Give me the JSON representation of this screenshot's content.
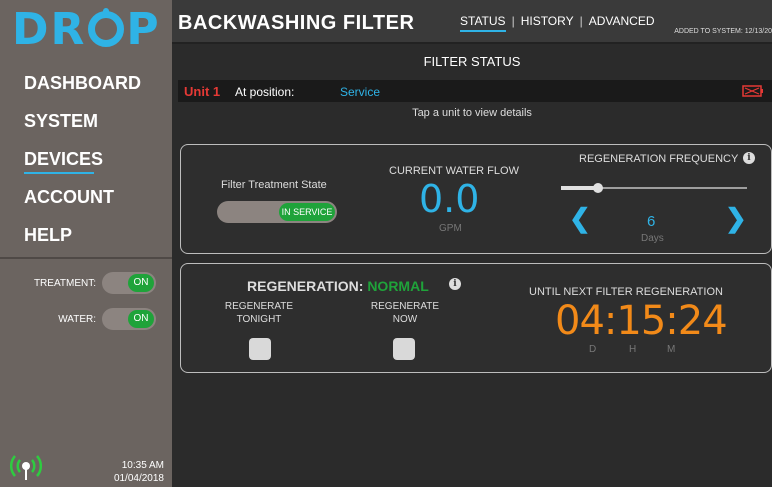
{
  "sidebar": {
    "logo": "DROP",
    "nav": [
      {
        "label": "DASHBOARD"
      },
      {
        "label": "SYSTEM"
      },
      {
        "label": "DEVICES"
      },
      {
        "label": "ACCOUNT"
      },
      {
        "label": "HELP"
      }
    ],
    "active_index": 2,
    "treatment": {
      "label": "TREATMENT:",
      "state": "ON"
    },
    "water": {
      "label": "WATER:",
      "state": "ON"
    },
    "time": "10:35 AM",
    "date": "01/04/2018"
  },
  "header": {
    "title": "BACKWASHING FILTER",
    "tabs": [
      {
        "label": "STATUS"
      },
      {
        "label": "HISTORY"
      },
      {
        "label": "ADVANCED"
      }
    ],
    "added": "ADDED TO SYSTEM: 12/13/20"
  },
  "main": {
    "section_title": "FILTER STATUS",
    "unit": {
      "name": "Unit 1",
      "position_label": "At position:",
      "position_value": "Service"
    },
    "tap_hint": "Tap a unit to view details",
    "filter_state": {
      "label": "Filter Treatment State",
      "value": "IN SERVICE"
    },
    "flow": {
      "label": "CURRENT WATER FLOW",
      "value": "0.0",
      "unit": "GPM"
    },
    "frequency": {
      "label": "REGENERATION FREQUENCY",
      "value": "6",
      "unit": "Days",
      "slider_fraction": 0.2
    },
    "regeneration": {
      "title": "REGENERATION:",
      "status": "NORMAL",
      "tonight_label_1": "REGENERATE",
      "tonight_label_2": "TONIGHT",
      "now_label_1": "REGENERATE",
      "now_label_2": "NOW",
      "next_label": "UNTIL NEXT FILTER REGENERATION",
      "countdown": "04:15:24",
      "unit_d": "D",
      "unit_h": "H",
      "unit_m": "M"
    }
  },
  "colors": {
    "accent": "#2fb3e6",
    "on_green": "#1fa33a",
    "unit_red": "#e53935",
    "countdown_orange": "#f28a19"
  }
}
